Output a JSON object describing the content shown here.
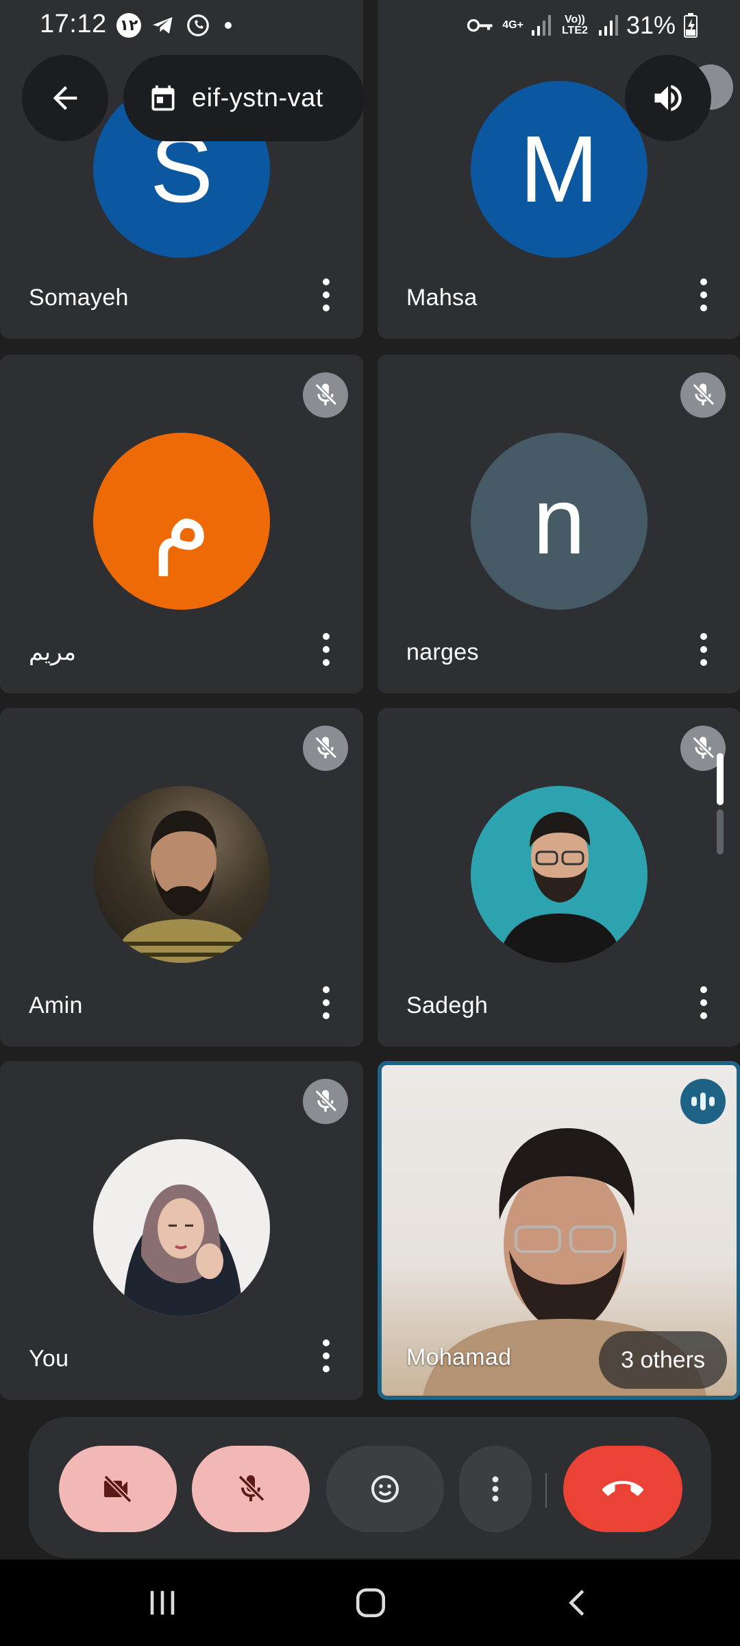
{
  "status_bar": {
    "time": "17:12",
    "date_badge": "۱۲",
    "network_label_1": "4G+",
    "network_label_2": "Vo)) LTE2",
    "battery": "31%"
  },
  "header": {
    "meeting_code": "eif-ystn-vat"
  },
  "tiles": [
    {
      "name": "Somayeh",
      "initial": "S",
      "avatar_color": "#0b57a0",
      "muted": false
    },
    {
      "name": "Mahsa",
      "initial": "M",
      "avatar_color": "#0b57a0",
      "muted": false
    },
    {
      "name": "مریم",
      "initial": "م",
      "avatar_color": "#ee6a07",
      "muted": true
    },
    {
      "name": "narges",
      "initial": "n",
      "avatar_color": "#455a64",
      "muted": true
    },
    {
      "name": "Amin",
      "initial": "",
      "avatar_color": "",
      "muted": true
    },
    {
      "name": "Sadegh",
      "initial": "",
      "avatar_color": "",
      "muted": true
    },
    {
      "name": "You",
      "initial": "",
      "avatar_color": "",
      "muted": true
    }
  ],
  "active_speaker": {
    "name": "Mohamad",
    "others_label": "3 others"
  },
  "colors": {
    "tile_bg": "#2d2f33",
    "accent_speaking": "#1e6386",
    "hangup": "#ea4335",
    "muted_control": "#f2b8b5"
  }
}
